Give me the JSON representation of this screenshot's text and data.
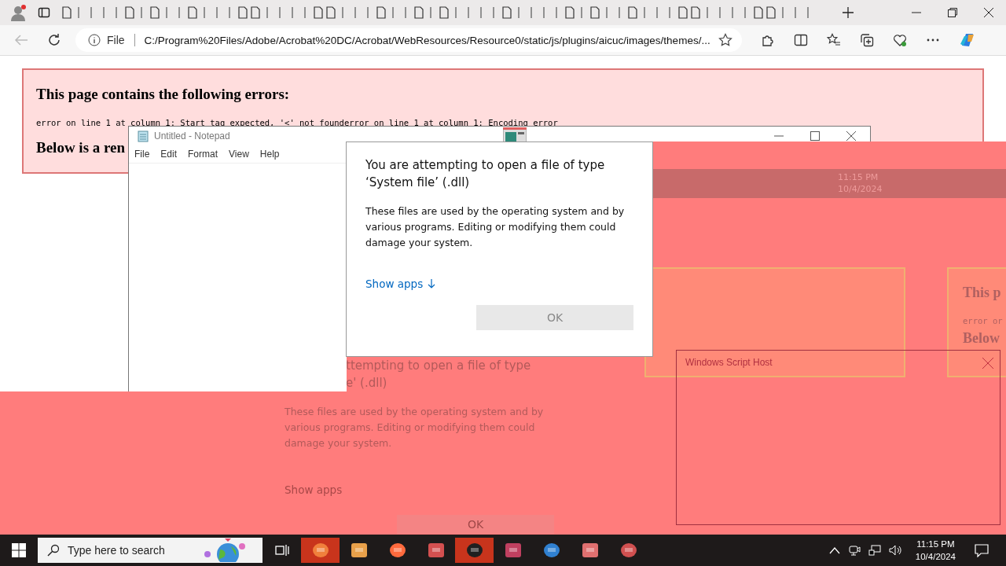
{
  "browser": {
    "address_label": "File",
    "url": "C:/Program%20Files/Adobe/Acrobat%20DC/Acrobat/WebResources/Resource0/static/js/plugins/aicuc/images/themes/..."
  },
  "error_page": {
    "heading": "This page contains the following errors:",
    "error_line": "error on line 1 at column 1: Start tag expected, '<' not founderror on line 1 at column 1: Encoding error",
    "below_text": "Below is a ren"
  },
  "notepad": {
    "title": "Untitled - Notepad",
    "menu": [
      "File",
      "Edit",
      "Format",
      "View",
      "Help"
    ]
  },
  "dialog": {
    "title": "You are attempting to open a file of type ‘System file’ (.dll)",
    "body": "These files are used by the operating system and by various programs. Editing or modifying them could damage your system.",
    "link": "Show apps",
    "button": {
      "label": "OK",
      "disabled": true
    }
  },
  "ghost": {
    "title_lines": [
      "ttempting to open a file of type",
      "e' (.dll)"
    ],
    "body": "These files are used by the operating system and by various programs. Editing or modifying them could damage your system.",
    "link": "Show apps",
    "button": "OK",
    "time": "11:15 PM",
    "date": "10/4/2024",
    "page_heading": "This p",
    "page_error": "error or",
    "page_below": "Below"
  },
  "script_host": {
    "title": "Windows Script Host"
  },
  "taskbar": {
    "search_placeholder": "Type here to search",
    "time": "11:15 PM",
    "date": "10/4/2024"
  }
}
